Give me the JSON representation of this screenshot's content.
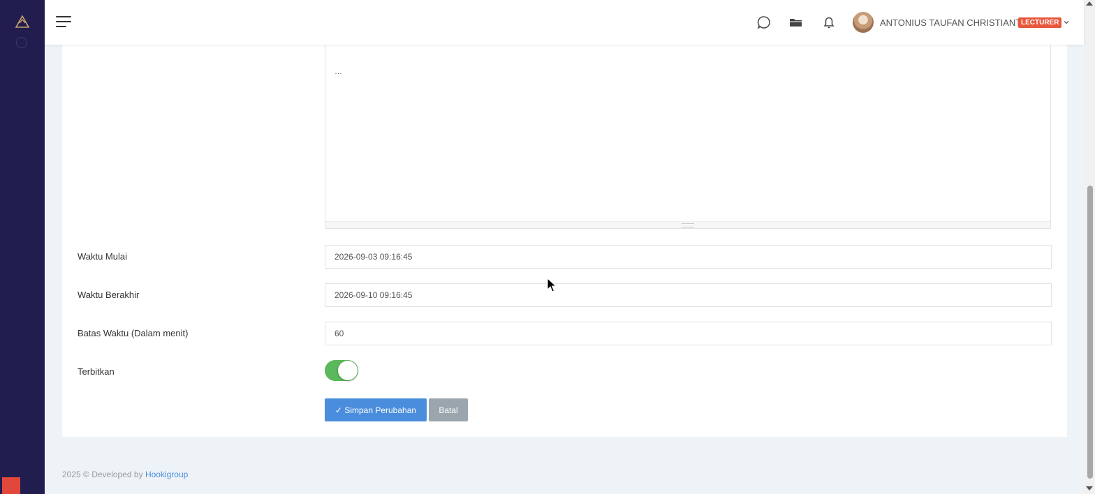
{
  "header": {
    "user_name": "ANTONIUS TAUFAN CHRISTIANTO",
    "role_badge": "LECTURER",
    "icons": [
      "menu-icon",
      "chat-icon",
      "folder-icon",
      "bell-icon",
      "chevron-down-icon"
    ]
  },
  "sidebar": {
    "logo": "app-logo-icon"
  },
  "form": {
    "editor_text": "…",
    "fields": {
      "start_time": {
        "label": "Waktu Mulai",
        "value": "2026-09-03 09:16:45"
      },
      "end_time": {
        "label": "Waktu Berakhir",
        "value": "2026-09-10 09:16:45"
      },
      "time_limit": {
        "label": "Batas Waktu (Dalam menit)",
        "value": "60"
      },
      "publish": {
        "label": "Terbitkan",
        "enabled": true
      }
    },
    "buttons": {
      "save": "✓ Simpan Perubahan",
      "cancel": "Batal"
    }
  },
  "footer": {
    "text": "2025 © Developed by",
    "link": "Hookigroup"
  },
  "colors": {
    "sidebar": "#211d4f",
    "primary": "#4a8ddc",
    "toggle_on": "#5cb85c",
    "badge": "#e8573c"
  }
}
